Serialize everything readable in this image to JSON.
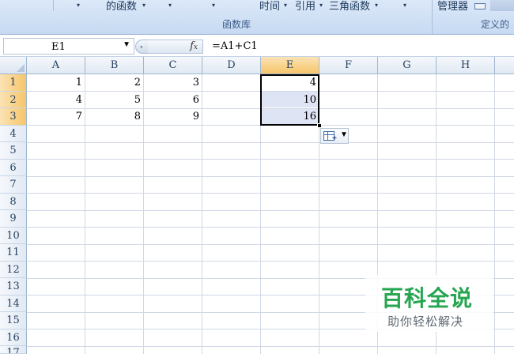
{
  "ribbon": {
    "items": [
      {
        "label": "的函数",
        "arrow": "▾"
      },
      {
        "label": "时间",
        "arrow": "▾"
      },
      {
        "label": "引用",
        "arrow": "▾"
      },
      {
        "label": "三角函数",
        "arrow": "▾"
      },
      {
        "label": "管理器"
      }
    ],
    "loose_arrows": [
      "▾",
      "▾",
      "▾",
      "▾"
    ],
    "group_labels": [
      "函数库",
      "定义的"
    ]
  },
  "formula_bar": {
    "cell_ref": "E1",
    "dropdown_icon": "dropdown-arrow-icon",
    "fx_label": "fx",
    "formula": "=A1+C1"
  },
  "sheet": {
    "columns": [
      "A",
      "B",
      "C",
      "D",
      "E",
      "F",
      "G",
      "H"
    ],
    "selected_column": "E",
    "rows": [
      "1",
      "2",
      "3",
      "4",
      "5",
      "6",
      "7",
      "8",
      "9",
      "10",
      "11",
      "12",
      "13",
      "14",
      "15",
      "16",
      "17"
    ],
    "selected_rows": [
      "1",
      "2",
      "3"
    ],
    "cells": [
      {
        "ref": "A1",
        "value": "1"
      },
      {
        "ref": "B1",
        "value": "2"
      },
      {
        "ref": "C1",
        "value": "3"
      },
      {
        "ref": "E1",
        "value": "4"
      },
      {
        "ref": "A2",
        "value": "4"
      },
      {
        "ref": "B2",
        "value": "5"
      },
      {
        "ref": "C2",
        "value": "6"
      },
      {
        "ref": "E2",
        "value": "10"
      },
      {
        "ref": "A3",
        "value": "7"
      },
      {
        "ref": "B3",
        "value": "8"
      },
      {
        "ref": "C3",
        "value": "9"
      },
      {
        "ref": "E3",
        "value": "16"
      }
    ],
    "selection": "E1:E3",
    "autofill_options_icon": "auto-fill-options-icon"
  },
  "watermark": {
    "title": "百科全说",
    "subtitle": "助你轻松解决",
    "color": "#26a650"
  }
}
